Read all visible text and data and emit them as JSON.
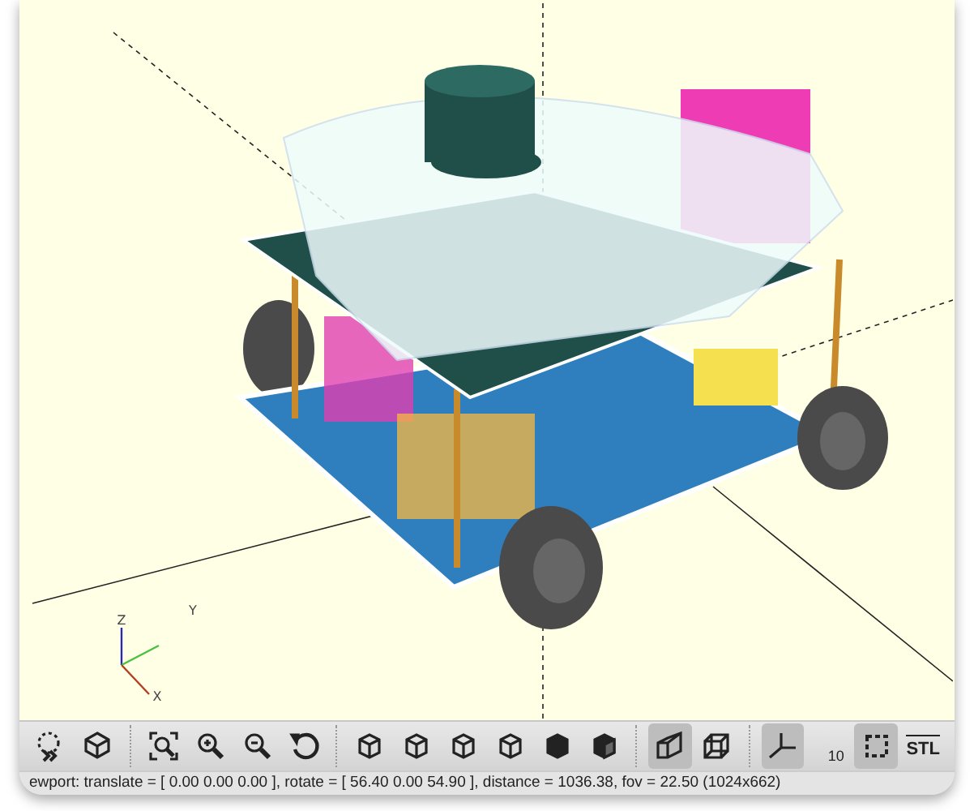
{
  "viewport": {
    "axis_labels": [
      {
        "kind": "x",
        "text": "X"
      },
      {
        "kind": "y",
        "text": "Y"
      },
      {
        "kind": "z",
        "text": "Z"
      }
    ]
  },
  "toolbar": [
    {
      "kind": "animate",
      "selected": false
    },
    {
      "kind": "render",
      "selected": false
    },
    {
      "kind": "view-all",
      "selected": false
    },
    {
      "kind": "zoom-in",
      "selected": false
    },
    {
      "kind": "zoom-out",
      "selected": false
    },
    {
      "kind": "reset-view",
      "selected": false
    },
    {
      "kind": "view-right",
      "selected": false
    },
    {
      "kind": "view-top",
      "selected": false
    },
    {
      "kind": "view-bottom",
      "selected": false
    },
    {
      "kind": "view-left",
      "selected": false
    },
    {
      "kind": "view-front",
      "selected": false
    },
    {
      "kind": "view-back",
      "selected": false
    },
    {
      "kind": "perspective",
      "selected": true
    },
    {
      "kind": "orthogonal",
      "selected": false
    },
    {
      "kind": "axes",
      "selected": true
    },
    {
      "kind": "scale-markers",
      "selected": false,
      "label": "10"
    },
    {
      "kind": "crosshairs",
      "selected": true
    },
    {
      "kind": "export-stl",
      "selected": false,
      "label": "STL"
    }
  ],
  "status_bar": "ewport: translate = [ 0.00 0.00 0.00 ], rotate = [ 56.40 0.00 54.90 ], distance = 1036.38, fov = 22.50 (1024x662)"
}
